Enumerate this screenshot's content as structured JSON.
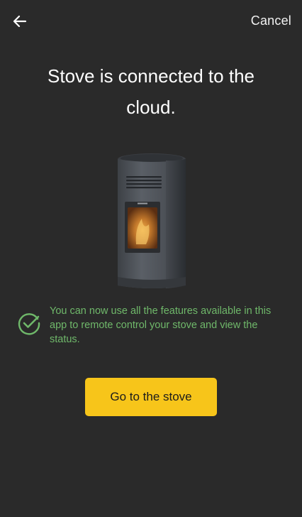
{
  "header": {
    "back_icon": "arrow-left-icon",
    "cancel_label": "Cancel"
  },
  "main": {
    "title": "Stove is connected to the cloud.",
    "image_subject": "pellet-stove",
    "status_icon": "check-circle-icon",
    "status_text": "You can now use all the features available in this app to remote control your stove and view the status.",
    "button_label": "Go to the stove"
  },
  "colors": {
    "background": "#2a2a2a",
    "accent": "#f7c51a",
    "success": "#6fb86a",
    "text": "#ffffff"
  }
}
